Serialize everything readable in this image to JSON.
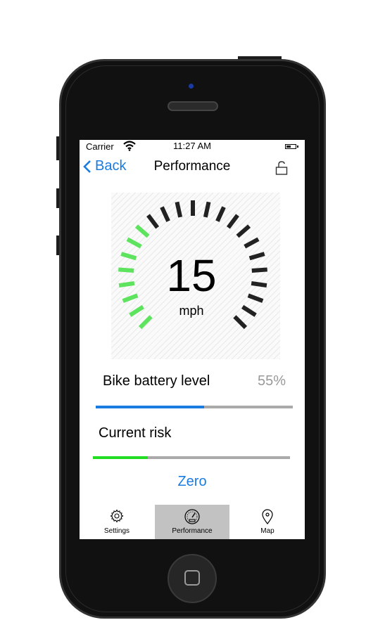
{
  "status_bar": {
    "carrier": "Carrier",
    "time": "11:27 AM"
  },
  "nav": {
    "back_label": "Back",
    "title": "Performance"
  },
  "speedometer": {
    "speed": "15",
    "unit": "mph",
    "total_ticks": 23,
    "active_ticks": 8,
    "active_color": "#5ee35e",
    "inactive_color": "#222222"
  },
  "battery": {
    "label": "Bike battery level",
    "value_text": "55%",
    "level": 0.55,
    "color": "#1a7ce0"
  },
  "risk": {
    "label": "Current risk",
    "level": 0.28,
    "color": "#22dd22",
    "value_text": "Zero"
  },
  "tabs": [
    {
      "label": "Settings",
      "icon": "gear-icon",
      "active": false
    },
    {
      "label": "Performance",
      "icon": "speedometer-icon",
      "active": true
    },
    {
      "label": "Map",
      "icon": "map-pin-icon",
      "active": false
    }
  ]
}
